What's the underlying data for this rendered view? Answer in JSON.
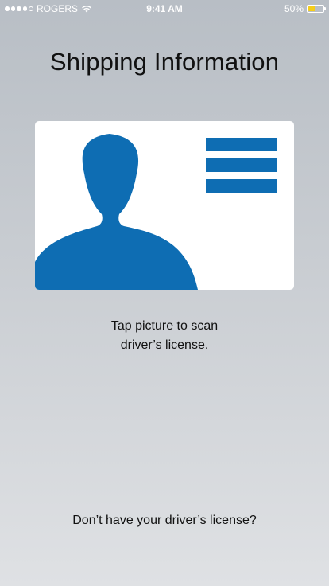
{
  "status_bar": {
    "carrier": "ROGERS",
    "time": "9:41 AM",
    "battery_percent": "50%",
    "battery_level": 0.5,
    "signal_bars_filled": 4,
    "signal_bars_total": 5,
    "battery_color": "#f5cd1a"
  },
  "page": {
    "title": "Shipping Information"
  },
  "license_card": {
    "icon": "driver-license-scan-icon",
    "accent_color": "#0e6db3"
  },
  "instructions": {
    "line1": "Tap picture to scan",
    "line2": "driver’s license."
  },
  "no_license_link": "Don’t have your driver’s license?"
}
